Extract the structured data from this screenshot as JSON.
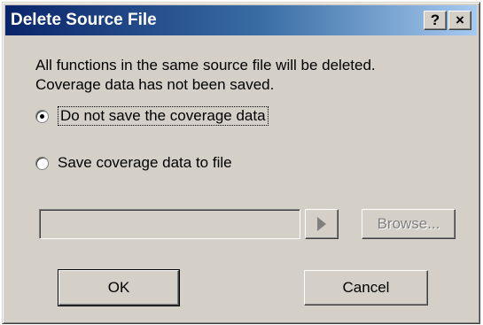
{
  "dialog": {
    "title": "Delete Source File",
    "help_label": "?",
    "close_label": "×"
  },
  "message": {
    "line1": "All functions in the same source file will be deleted.",
    "line2": "Coverage data has not been saved."
  },
  "options": [
    {
      "label": "Do not save the coverage data",
      "selected": true
    },
    {
      "label": "Save coverage data to file",
      "selected": false
    }
  ],
  "file_path": {
    "value": ""
  },
  "buttons": {
    "browse": "Browse...",
    "ok": "OK",
    "cancel": "Cancel"
  },
  "icons": {
    "arrow": "play-arrow-icon"
  }
}
